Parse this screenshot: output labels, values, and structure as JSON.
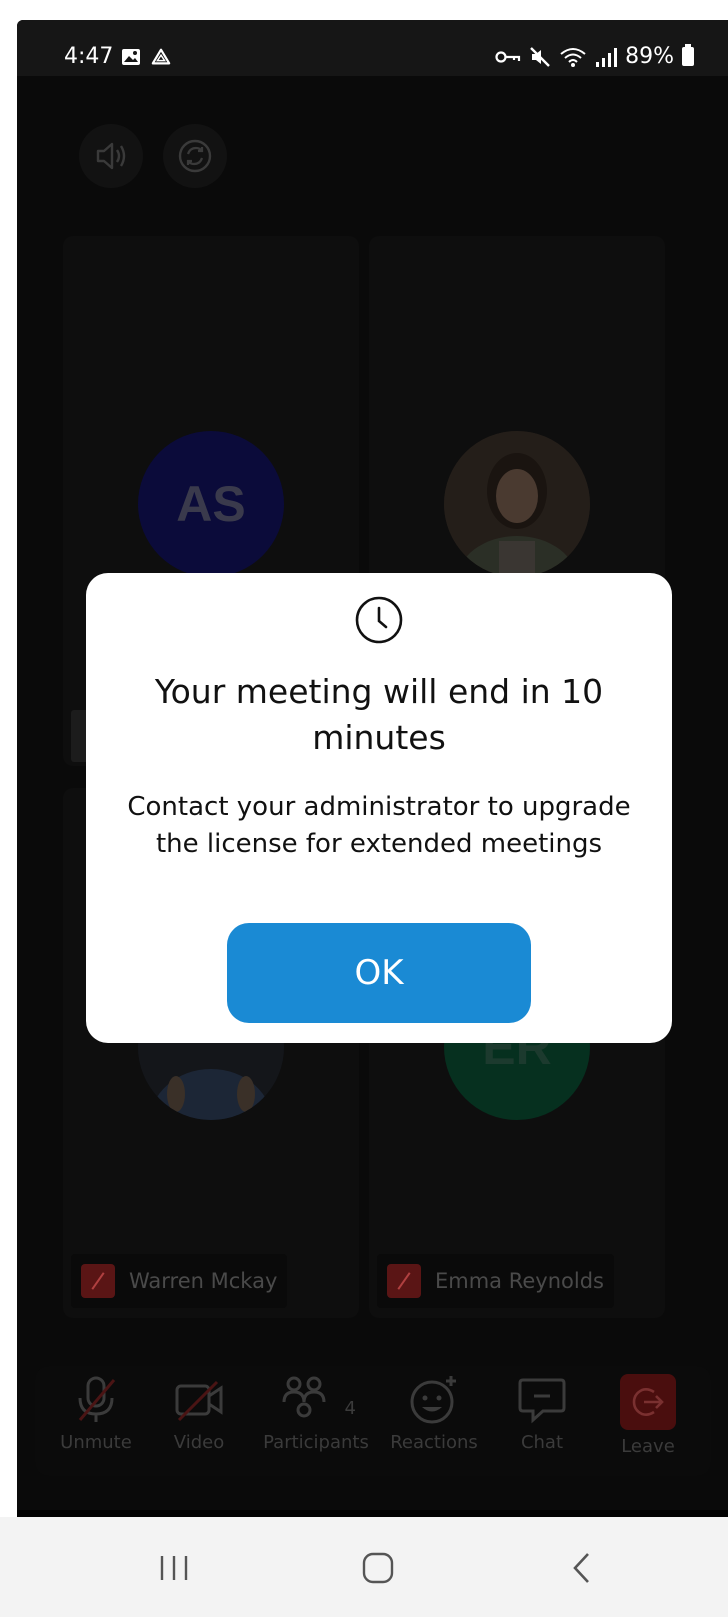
{
  "status_bar": {
    "time": "4:47",
    "battery": "89%",
    "left_icons": [
      "image-icon",
      "drive-icon"
    ],
    "right_icons": [
      "vpn-key-icon",
      "mute-icon",
      "wifi-icon",
      "signal-icon",
      "battery-icon"
    ]
  },
  "stage": {
    "top_buttons": [
      "speaker-icon",
      "camera-switch-icon"
    ],
    "participants": [
      {
        "initials": "AS",
        "avatar_color": "#0b0b3a"
      },
      {
        "initials": "",
        "avatar_type": "photo"
      },
      {
        "name": "Warren Mckay",
        "avatar_type": "photo",
        "muted": true
      },
      {
        "name": "Emma Reynolds",
        "initials": "ER",
        "avatar_color": "#06301f",
        "muted": true
      }
    ]
  },
  "toolbar": {
    "unmute": "Unmute",
    "video": "Video",
    "participants": "Participants",
    "participants_count": "4",
    "reactions": "Reactions",
    "chat": "Chat",
    "leave": "Leave"
  },
  "modal": {
    "icon": "clock-icon",
    "title": "Your meeting will end in 10 minutes",
    "body": "Contact your administrator to upgrade the license for extended meetings",
    "ok_label": "OK",
    "accent": "#1a8ad4"
  },
  "nav_bar": {
    "buttons": [
      "recents-icon",
      "home-icon",
      "back-icon"
    ]
  }
}
